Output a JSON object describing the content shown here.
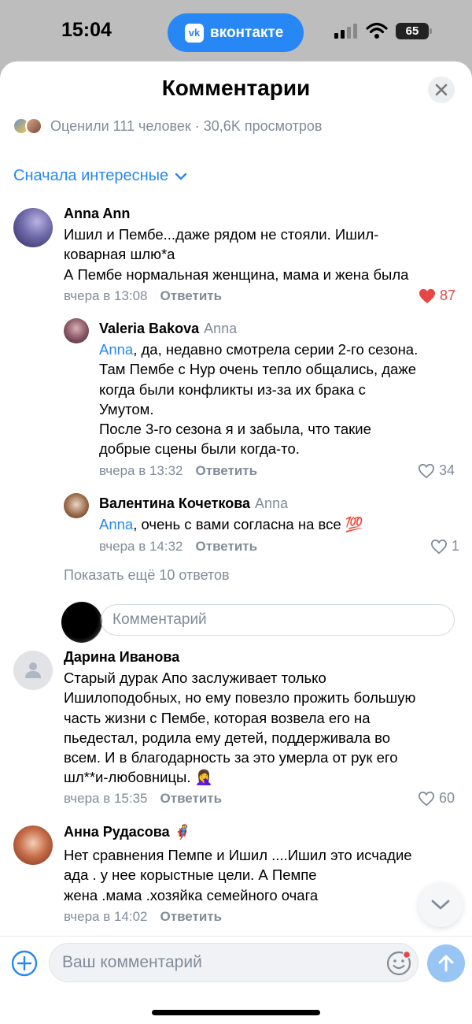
{
  "status_bar": {
    "time": "15:04",
    "app_pill": "вконтакте",
    "vk_logo": "vk",
    "battery": "65"
  },
  "header": {
    "title": "Комментарии"
  },
  "rating": {
    "text": "Оценили 111 человек · 30,6K просмотров"
  },
  "sort": {
    "label": "Сначала интересные"
  },
  "comments": [
    {
      "author": "Anna Ann",
      "text": "Ишил и Пембе...даже рядом не стояли. Ишил-\nковарная шлю*а\nА Пембе нормальная женщина, мама и жена была",
      "time": "вчера в 13:08",
      "reply": "Ответить",
      "likes": "87",
      "liked": true
    },
    {
      "author": "Valeria Bakova",
      "reply_to": "Anna",
      "mention": "Anna",
      "text": ", да, недавно смотрела серии 2-го сезона.\nТам Пембе с Нур очень тепло общались, даже\nкогда были конфликты из-за их брака с\nУмутом.\nПосле 3-го сезона я и забыла, что такие\nдобрые сцены были когда-то.",
      "time": "вчера в 13:32",
      "reply": "Ответить",
      "likes": "34"
    },
    {
      "author": "Валентина Кочеткова",
      "reply_to": "Anna",
      "mention": "Anna",
      "text": ", очень с вами согласна на все 💯",
      "time": "вчера в 14:32",
      "reply": "Ответить",
      "likes": "1"
    },
    {
      "author": "Дарина Иванова",
      "text": "Старый дурак Апо заслуживает только\nИшилоподобных, но ему повезло прожить большую\nчасть жизни с Пембе, которая возвела его на\nпьедестал, родила ему детей, поддерживала во\nвсем. И в благодарность за это умерла от рук его\nшл**и-любовницы. 🤦‍♀️",
      "time": "вчера в 15:35",
      "reply": "Ответить",
      "likes": "60"
    },
    {
      "author": "Анна Рудасова",
      "author_badge": "🦸",
      "text": "Нет сравнения Пемпе и Ишил ....Ишил это исчадие\nада . у нее корыстные цели. А Пемпе\nжена .мама  .хозяйка семейного очага",
      "time": "вчера в 14:02",
      "reply": "Ответить"
    }
  ],
  "show_more": "Показать ещё 10 ответов",
  "inline_reply": {
    "placeholder": "Комментарий"
  },
  "composer": {
    "placeholder": "Ваш комментарий"
  },
  "colors": {
    "accent": "#2787f5",
    "secondary_text": "#818c99",
    "like_red": "#e64646"
  },
  "icons": [
    "vk-logo-icon",
    "signal-icon",
    "wifi-icon",
    "battery-icon",
    "close-icon",
    "chevron-down-icon",
    "heart-icon",
    "add-icon",
    "emoji-icon",
    "send-icon",
    "user-placeholder-icon"
  ]
}
